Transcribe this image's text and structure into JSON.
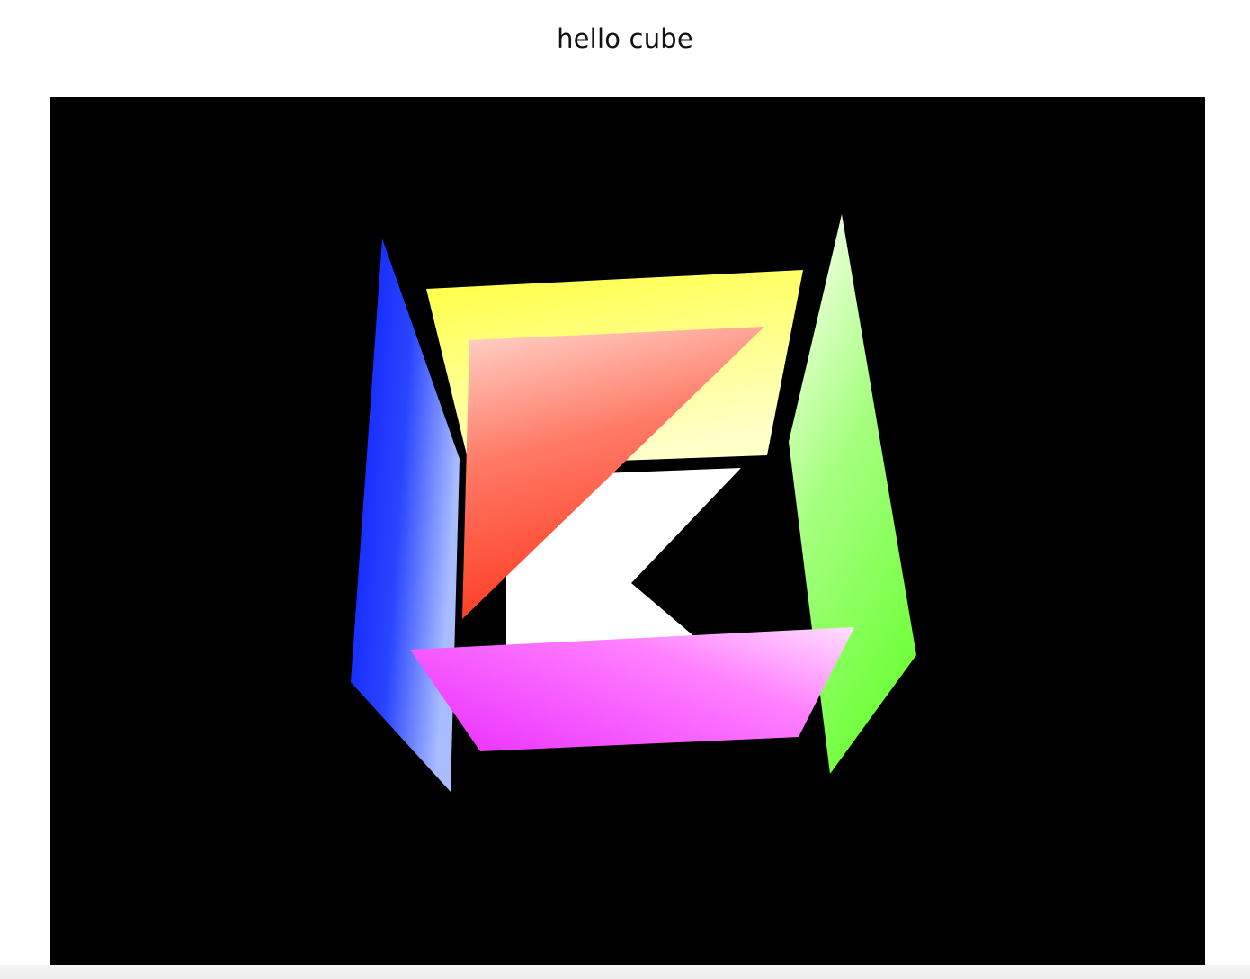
{
  "page": {
    "title": "hello cube"
  },
  "scene": {
    "background": "#000000",
    "logo_color": "#ffffff",
    "faces": [
      {
        "name": "left-face",
        "color": "#1a2bff",
        "highlight": "#9fb4ff"
      },
      {
        "name": "right-face",
        "color": "#6cff3a",
        "highlight": "#f4ffe0"
      },
      {
        "name": "top-face",
        "color": "#ffff4d",
        "highlight": "#ffffd0"
      },
      {
        "name": "front-face",
        "color": "#ff3b24",
        "highlight": "#ffd2c8"
      },
      {
        "name": "bottom-face",
        "color": "#f03cff",
        "highlight": "#ffd6ff"
      }
    ]
  }
}
